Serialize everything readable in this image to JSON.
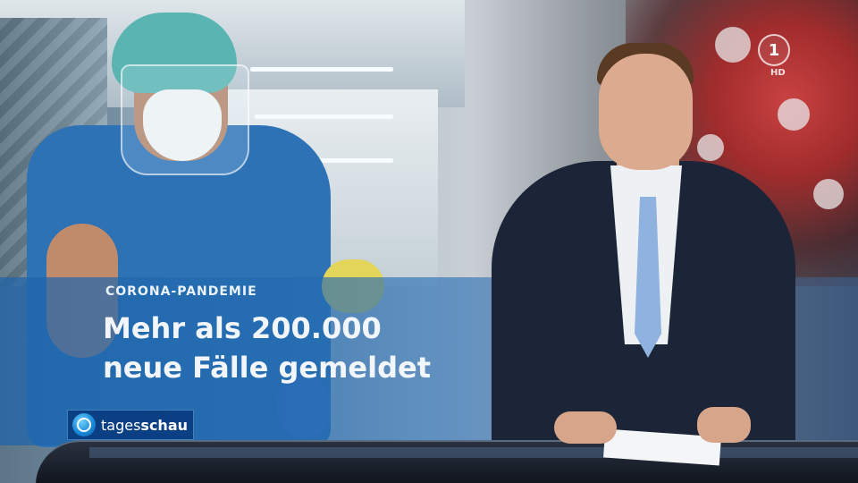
{
  "channel_bug": {
    "logo": "1",
    "quality": "HD"
  },
  "lower_third": {
    "kicker": "CORONA-PANDEMIE",
    "headline_line1": "Mehr als 200.000",
    "headline_line2": "neue Fälle gemeldet"
  },
  "show_logo": {
    "prefix": "tages",
    "suffix": "schau"
  },
  "colors": {
    "band_blue": "#1e64aa",
    "logo_blue": "#0a3f84",
    "nurse_scrubs": "#2c72b5",
    "suit_navy": "#1c2438",
    "tie_blue": "#8fb3de"
  }
}
